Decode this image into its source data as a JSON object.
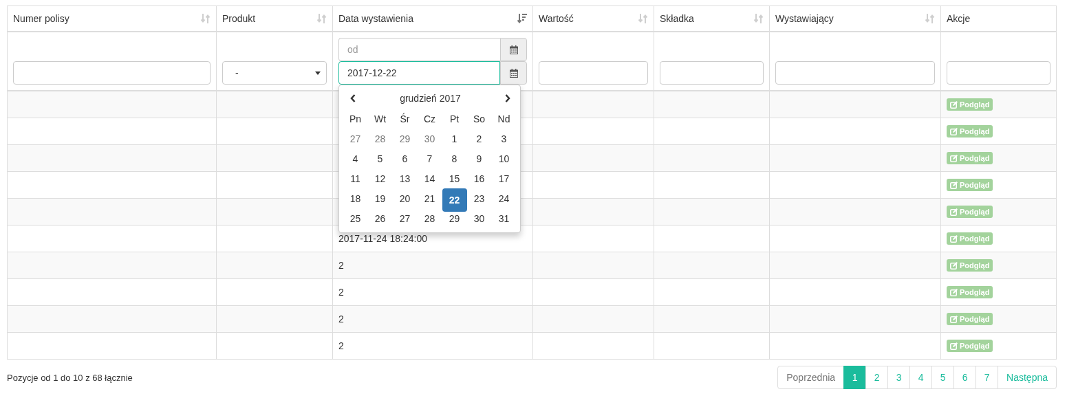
{
  "columns": [
    {
      "label": "Numer polisy",
      "sortable": true,
      "sorted": false
    },
    {
      "label": "Produkt",
      "sortable": true,
      "sorted": false
    },
    {
      "label": "Data wystawienia",
      "sortable": true,
      "sorted": true
    },
    {
      "label": "Wartość",
      "sortable": true,
      "sorted": false
    },
    {
      "label": "Składka",
      "sortable": true,
      "sorted": false
    },
    {
      "label": "Wystawiający",
      "sortable": true,
      "sorted": false
    },
    {
      "label": "Akcje",
      "sortable": false
    }
  ],
  "filters": [
    {
      "kind": "text"
    },
    {
      "kind": "select",
      "value": "-"
    },
    {
      "kind": "daterange",
      "from": {
        "placeholder": "od",
        "focused": false
      },
      "to": {
        "value": "2017-12-22",
        "focused": true
      }
    },
    {
      "kind": "text"
    },
    {
      "kind": "text"
    },
    {
      "kind": "text"
    },
    {
      "kind": "text"
    }
  ],
  "datepicker": {
    "title": "grudzień 2017",
    "weekdays": [
      "Pn",
      "Wt",
      "Śr",
      "Cz",
      "Pt",
      "So",
      "Nd"
    ],
    "weeks": [
      [
        {
          "day": "27",
          "other_month": true,
          "selected": false
        },
        {
          "day": "28",
          "other_month": true,
          "selected": false
        },
        {
          "day": "29",
          "other_month": true,
          "selected": false
        },
        {
          "day": "30",
          "other_month": true,
          "selected": false
        },
        {
          "day": "1",
          "other_month": false,
          "selected": false
        },
        {
          "day": "2",
          "other_month": false,
          "selected": false
        },
        {
          "day": "3",
          "other_month": false,
          "selected": false
        }
      ],
      [
        {
          "day": "4",
          "other_month": false,
          "selected": false
        },
        {
          "day": "5",
          "other_month": false,
          "selected": false
        },
        {
          "day": "6",
          "other_month": false,
          "selected": false
        },
        {
          "day": "7",
          "other_month": false,
          "selected": false
        },
        {
          "day": "8",
          "other_month": false,
          "selected": false
        },
        {
          "day": "9",
          "other_month": false,
          "selected": false
        },
        {
          "day": "10",
          "other_month": false,
          "selected": false
        }
      ],
      [
        {
          "day": "11",
          "other_month": false,
          "selected": false
        },
        {
          "day": "12",
          "other_month": false,
          "selected": false
        },
        {
          "day": "13",
          "other_month": false,
          "selected": false
        },
        {
          "day": "14",
          "other_month": false,
          "selected": false
        },
        {
          "day": "15",
          "other_month": false,
          "selected": false
        },
        {
          "day": "16",
          "other_month": false,
          "selected": false
        },
        {
          "day": "17",
          "other_month": false,
          "selected": false
        }
      ],
      [
        {
          "day": "18",
          "other_month": false,
          "selected": false
        },
        {
          "day": "19",
          "other_month": false,
          "selected": false
        },
        {
          "day": "20",
          "other_month": false,
          "selected": false
        },
        {
          "day": "21",
          "other_month": false,
          "selected": false
        },
        {
          "day": "22",
          "other_month": false,
          "selected": true
        },
        {
          "day": "23",
          "other_month": false,
          "selected": false
        },
        {
          "day": "24",
          "other_month": false,
          "selected": false
        }
      ],
      [
        {
          "day": "25",
          "other_month": false,
          "selected": false
        },
        {
          "day": "26",
          "other_month": false,
          "selected": false
        },
        {
          "day": "27",
          "other_month": false,
          "selected": false
        },
        {
          "day": "28",
          "other_month": false,
          "selected": false
        },
        {
          "day": "29",
          "other_month": false,
          "selected": false
        },
        {
          "day": "30",
          "other_month": false,
          "selected": false
        },
        {
          "day": "31",
          "other_month": false,
          "selected": false
        }
      ]
    ]
  },
  "rows": [
    {
      "action": "Podgląd"
    },
    {
      "action": "Podgląd"
    },
    {
      "action": "Podgląd"
    },
    {
      "action": "Podgląd"
    },
    {
      "action": "Podgląd"
    },
    {
      "date": "2017-11-24 18:24:00",
      "action": "Podgląd"
    },
    {
      "date": "2",
      "action": "Podgląd"
    },
    {
      "date": "2",
      "action": "Podgląd"
    },
    {
      "date": "2",
      "action": "Podgląd"
    },
    {
      "date": "2",
      "action": "Podgląd"
    }
  ],
  "footer": {
    "info": "Pozycje od 1 do 10 z 68 łącznie",
    "pagination": {
      "previous": "Poprzednia",
      "pages": [
        {
          "label": "1",
          "selected": true
        },
        {
          "label": "2",
          "selected": false
        },
        {
          "label": "3",
          "selected": false
        },
        {
          "label": "4",
          "selected": false
        },
        {
          "label": "5",
          "selected": false
        },
        {
          "label": "6",
          "selected": false
        },
        {
          "label": "7",
          "selected": false
        }
      ],
      "next": "Następna"
    }
  }
}
